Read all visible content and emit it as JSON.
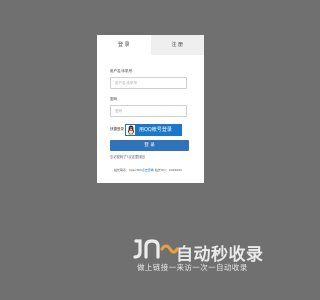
{
  "tabs": [
    {
      "label": "登 录",
      "active": true
    },
    {
      "label": "注 册",
      "active": false
    }
  ],
  "form": {
    "account_label": "用户名/手机号",
    "account_placeholder": "用户名/手机号",
    "password_label": "密码",
    "password_placeholder": "密码",
    "quick_login_label": "快捷登录",
    "qq_button_label": "用QQ帐号登录",
    "login_button_label": "登 录",
    "forgot_link": "忘记密码了?点这里找回",
    "contact_prefix": "站长联系：",
    "contact_email_user": "lijian360",
    "contact_email_link": "点击查看",
    "contact_qq_label": "  站长QQ：",
    "contact_qq": "1069692"
  },
  "watermark": {
    "title": "自动秒收录",
    "subtitle": "做上链接一来访一次一自动收录"
  },
  "colors": {
    "background": "#707070",
    "primary": "#3173ba",
    "qq_blue": "#1b77c9"
  }
}
